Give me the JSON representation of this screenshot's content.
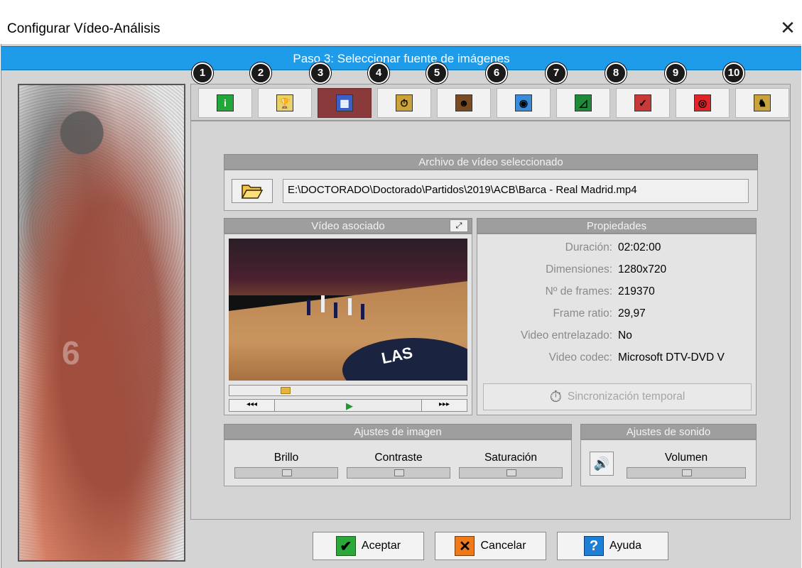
{
  "window": {
    "title": "Configurar Vídeo-Análisis",
    "close_glyph": "✕"
  },
  "step_bar": {
    "text": "Paso 3: Seleccionar fuente de imágenes"
  },
  "tabs": [
    {
      "number": "1",
      "icon": "info-icon",
      "glyph": "i",
      "color": "#22a83a"
    },
    {
      "number": "2",
      "icon": "trophy-icon",
      "glyph": "🏆",
      "color": "#e8d36a"
    },
    {
      "number": "3",
      "icon": "video-tape-icon",
      "glyph": "▦",
      "color": "#3a5fc8",
      "active": true
    },
    {
      "number": "4",
      "icon": "stopwatch-icon",
      "glyph": "⏱",
      "color": "#c9a23a"
    },
    {
      "number": "5",
      "icon": "player-icon",
      "glyph": "☻",
      "color": "#7a4a22"
    },
    {
      "number": "6",
      "icon": "eye-icon",
      "glyph": "◉",
      "color": "#3a8cd8"
    },
    {
      "number": "7",
      "icon": "field-icon",
      "glyph": "◿",
      "color": "#1f8a3a"
    },
    {
      "number": "8",
      "icon": "line-chart-icon",
      "glyph": "✓",
      "color": "#c83a3a"
    },
    {
      "number": "9",
      "icon": "target-icon",
      "glyph": "◎",
      "color": "#e0242a"
    },
    {
      "number": "10",
      "icon": "horse-icon",
      "glyph": "♞",
      "color": "#c8a23a"
    }
  ],
  "file_group": {
    "header": "Archivo de vídeo seleccionado",
    "path": "E:\\DOCTORADO\\Doctorado\\Partidos\\2019\\ACB\\Barca - Real Madrid.mp4",
    "folder_icon": "folder-open-icon"
  },
  "video_group": {
    "header": "Vídeo asociado",
    "rewind_label": "◂◂◂",
    "forward_label": "▸▸▸",
    "play_glyph": "▶",
    "court_text": "LAS",
    "progress": 0.1
  },
  "properties": {
    "header": "Propiedades",
    "rows": [
      {
        "label": "Duración:",
        "value": "02:02:00"
      },
      {
        "label": "Dimensiones:",
        "value": "1280x720"
      },
      {
        "label": "Nº de frames:",
        "value": "219370"
      },
      {
        "label": "Frame ratio:",
        "value": "29,97"
      },
      {
        "label": "Video entrelazado:",
        "value": "No"
      },
      {
        "label": "Video codec:",
        "value": "Microsoft DTV-DVD V"
      }
    ],
    "sync_button": "Sincronización temporal"
  },
  "image_settings": {
    "header": "Ajustes de imagen",
    "brillo": "Brillo",
    "contraste": "Contraste",
    "saturacion": "Saturación"
  },
  "sound_settings": {
    "header": "Ajustes de sonido",
    "volumen": "Volumen"
  },
  "buttons": {
    "accept": "Aceptar",
    "cancel": "Cancelar",
    "help": "Ayuda"
  },
  "left_image": {
    "jersey_number": "6"
  }
}
